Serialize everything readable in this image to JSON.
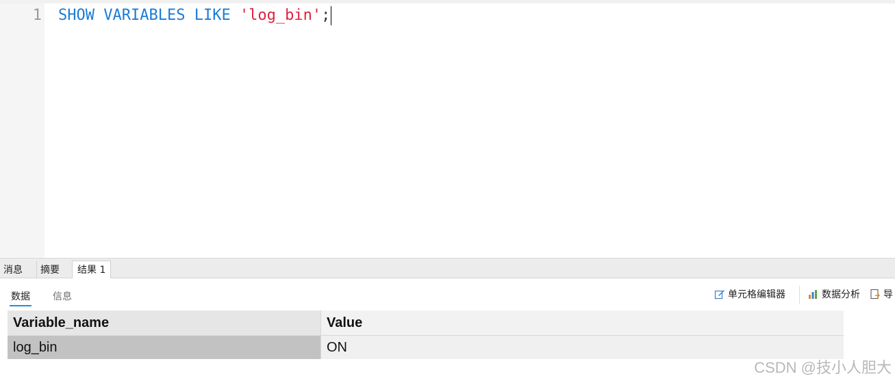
{
  "editor": {
    "line_number": "1",
    "code": {
      "kw_show": "SHOW",
      "kw_variables": "VARIABLES",
      "kw_like": "LIKE",
      "string_literal": "'log_bin'",
      "terminator": ";"
    }
  },
  "result_tabs": [
    "消息",
    "摘要",
    "结果 1"
  ],
  "active_result_tab": "结果 1",
  "sub_tabs": [
    "数据",
    "信息"
  ],
  "active_sub_tab": "数据",
  "toolbar": {
    "cell_editor": "单元格编辑器",
    "data_analysis": "数据分析",
    "export": "导"
  },
  "grid": {
    "columns": [
      "Variable_name",
      "Value"
    ],
    "rows": [
      [
        "log_bin",
        "ON"
      ]
    ]
  },
  "watermark": "CSDN @技小人胆大",
  "colors": {
    "keyword": "#1a7bd6",
    "string": "#e0213f",
    "tab_underline": "#1e8fd8"
  }
}
